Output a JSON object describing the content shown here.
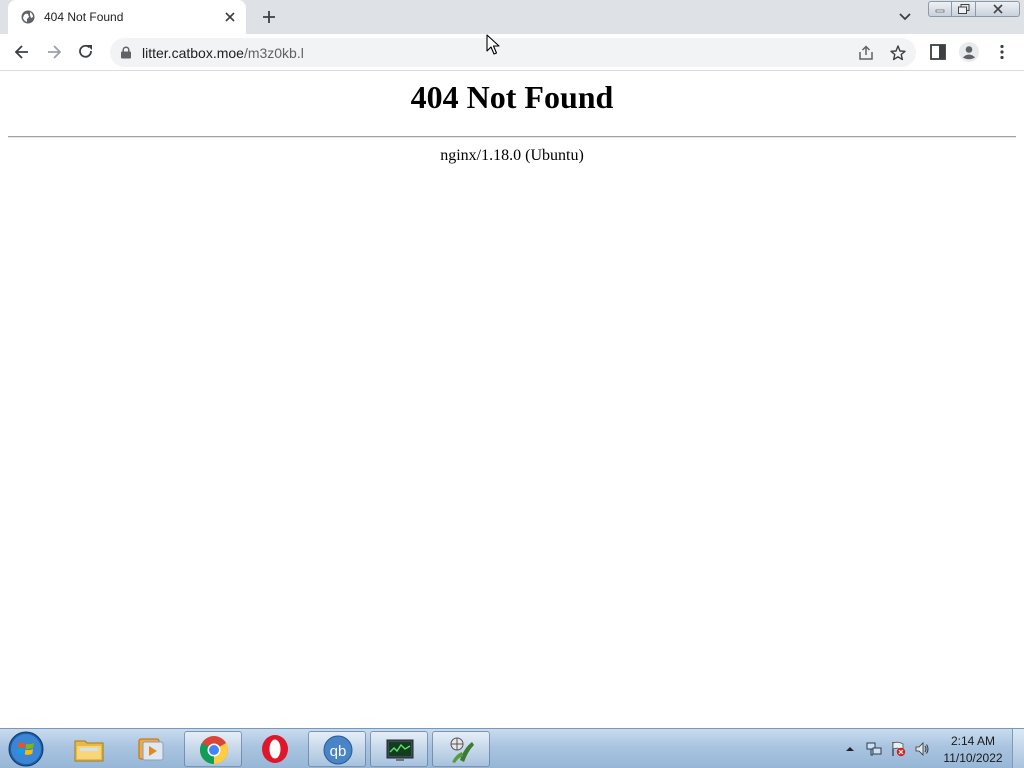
{
  "browser": {
    "tab": {
      "title": "404 Not Found",
      "favicon": "globe-icon"
    },
    "address_bar": {
      "domain": "litter.catbox.moe",
      "path": "/m3z0kb.l"
    },
    "colors": {
      "tabstrip": "#dee1e6",
      "omnibox": "#f1f3f4"
    }
  },
  "page": {
    "heading": "404 Not Found",
    "server": "nginx/1.18.0 (Ubuntu)"
  },
  "taskbar": {
    "start": "windows-start-orb-icon",
    "items": [
      {
        "name": "file-explorer-icon",
        "active": false
      },
      {
        "name": "media-player-icon",
        "active": false
      },
      {
        "name": "chrome-icon",
        "active": true
      },
      {
        "name": "opera-icon",
        "active": false
      },
      {
        "name": "qbittorrent-icon",
        "active": true
      },
      {
        "name": "system-monitor-icon",
        "active": true
      },
      {
        "name": "game-app-icon",
        "active": true
      }
    ],
    "tray_icons": [
      "show-hidden-icons-arrow",
      "network-icon",
      "action-center-flag-icon",
      "volume-icon"
    ],
    "clock": {
      "time": "2:14 AM",
      "date": "11/10/2022"
    }
  }
}
